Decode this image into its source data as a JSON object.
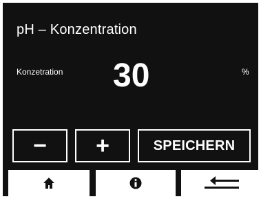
{
  "header": {
    "title": "pH – Konzentration"
  },
  "setting": {
    "label": "Konzetration",
    "value": "30",
    "unit": "%"
  },
  "controls": {
    "minus_label": "−",
    "plus_label": "+",
    "save_label": "SPEICHERN"
  },
  "footer": {
    "home_icon": "home-icon",
    "info_icon": "info-icon",
    "back_icon": "return-arrow-icon"
  },
  "colors": {
    "background": "#111111",
    "foreground": "#ffffff"
  }
}
